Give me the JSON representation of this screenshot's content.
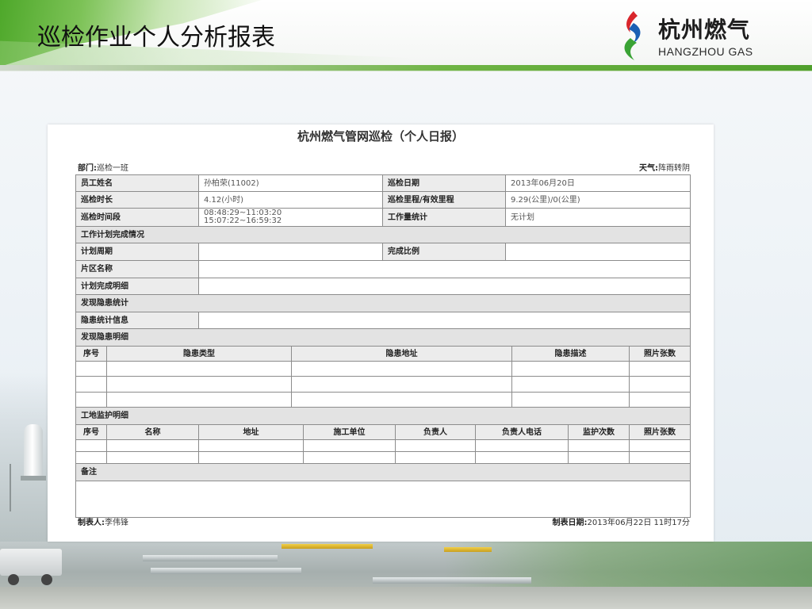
{
  "slide": {
    "title": "巡检作业个人分析报表"
  },
  "logo": {
    "icon": "flame-logo-icon",
    "name_cn": "杭州燃气",
    "name_en": "HANGZHOU GAS",
    "colors": [
      "#d9262c",
      "#1a5fb4",
      "#3aa335"
    ]
  },
  "report": {
    "title": "杭州燃气管网巡检（个人日报）",
    "department_label": "部门:",
    "department": "巡检一班",
    "weather_label": "天气:",
    "weather": "阵雨转阴",
    "info": {
      "employee_name_label": "员工姓名",
      "employee_name": "孙柏荣(11002)",
      "date_label": "巡检日期",
      "date": "2013年06月20日",
      "duration_label": "巡检时长",
      "duration": "4.12(小时)",
      "mileage_label": "巡检里程/有效里程",
      "mileage": "9.29(公里)/0(公里)",
      "time_range_label": "巡检时间段",
      "time_ranges": [
        "08:48:29~11:03:20",
        "15:07:22~16:59:32"
      ],
      "workload_label": "工作量统计",
      "workload": "无计划"
    },
    "plan": {
      "section_label": "工作计划完成情况",
      "period_label": "计划周期",
      "ratio_label": "完成比例",
      "area_label": "片区名称",
      "detail_label": "计划完成明细"
    },
    "hazard_stats": {
      "section_label": "发现隐患统计",
      "info_label": "隐患统计信息"
    },
    "hazard_detail": {
      "section_label": "发现隐患明细",
      "columns": [
        "序号",
        "隐患类型",
        "隐患地址",
        "隐患描述",
        "照片张数"
      ]
    },
    "site_monitor": {
      "section_label": "工地监护明细",
      "columns": [
        "序号",
        "名称",
        "地址",
        "施工单位",
        "负责人",
        "负责人电话",
        "监护次数",
        "照片张数"
      ]
    },
    "remarks": {
      "label": "备注"
    },
    "footer": {
      "maker_label": "制表人:",
      "maker": "李伟锋",
      "date_label": "制表日期:",
      "date": "2013年06月22日 11时17分"
    }
  }
}
